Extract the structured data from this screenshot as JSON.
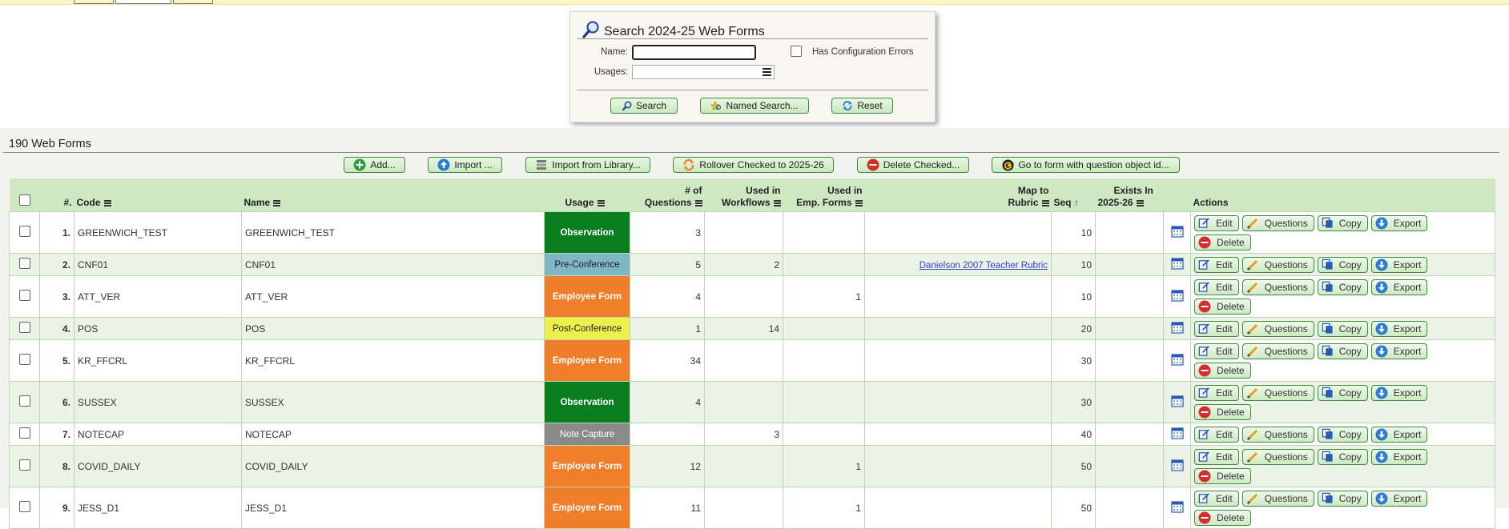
{
  "search": {
    "title": "Search 2024-25 Web Forms",
    "name_label": "Name:",
    "name_value": "",
    "usages_label": "Usages:",
    "config_errors_label": "Has Configuration Errors",
    "search_label": "Search",
    "named_search_label": "Named Search...",
    "reset_label": "Reset"
  },
  "main": {
    "title": "190 Web Forms",
    "toolbar": {
      "add": "Add...",
      "import": "Import ...",
      "import_library": "Import from Library...",
      "rollover": "Rollover Checked to 2025-26",
      "delete_checked": "Delete Checked...",
      "goto_form": "Go to form with question object id..."
    }
  },
  "table": {
    "headers": {
      "num": "#.",
      "code": "Code",
      "name": "Name",
      "usage": "Usage",
      "questions_1": "# of",
      "questions_2": "Questions",
      "workflows_1": "Used in",
      "workflows_2": "Workflows",
      "empforms_1": "Used in",
      "empforms_2": "Emp. Forms",
      "rubric_1": "Map to",
      "rubric_2": "Rubric",
      "seq": "Seq",
      "exists_1": "Exists In",
      "exists_2": "2025-26",
      "actions": "Actions"
    },
    "action_labels": {
      "edit": "Edit",
      "questions": "Questions",
      "copy": "Copy",
      "export": "Export",
      "delete": "Delete"
    },
    "usage_colors": {
      "Observation": "#0a7d1e",
      "Pre-Conference": "#7fb6c6",
      "Employee Form": "#f07d2a",
      "Post-Conference": "#ecf04a",
      "Note Capture": "#8a8a8a"
    },
    "rows": [
      {
        "num": "1.",
        "code": "GREENWICH_TEST",
        "name": "GREENWICH_TEST",
        "usage": "Observation",
        "questions": "3",
        "workflows": "",
        "empforms": "",
        "rubric": "",
        "seq": "10",
        "delete": true
      },
      {
        "num": "2.",
        "code": "CNF01",
        "name": "CNF01",
        "usage": "Pre-Conference",
        "questions": "5",
        "workflows": "2",
        "empforms": "",
        "rubric": "Danielson 2007 Teacher Rubric",
        "seq": "10",
        "delete": false
      },
      {
        "num": "3.",
        "code": "ATT_VER",
        "name": "ATT_VER",
        "usage": "Employee Form",
        "questions": "4",
        "workflows": "",
        "empforms": "1",
        "rubric": "",
        "seq": "10",
        "delete": true
      },
      {
        "num": "4.",
        "code": "POS",
        "name": "POS",
        "usage": "Post-Conference",
        "questions": "1",
        "workflows": "14",
        "empforms": "",
        "rubric": "",
        "seq": "20",
        "delete": false
      },
      {
        "num": "5.",
        "code": "KR_FFCRL",
        "name": "KR_FFCRL",
        "usage": "Employee Form",
        "questions": "34",
        "workflows": "",
        "empforms": "",
        "rubric": "",
        "seq": "30",
        "delete": true
      },
      {
        "num": "6.",
        "code": "SUSSEX",
        "name": "SUSSEX",
        "usage": "Observation",
        "questions": "4",
        "workflows": "",
        "empforms": "",
        "rubric": "",
        "seq": "30",
        "delete": true
      },
      {
        "num": "7.",
        "code": "NOTECAP",
        "name": "NOTECAP",
        "usage": "Note Capture",
        "questions": "",
        "workflows": "3",
        "empforms": "",
        "rubric": "",
        "seq": "40",
        "delete": false
      },
      {
        "num": "8.",
        "code": "COVID_DAILY",
        "name": "COVID_DAILY",
        "usage": "Employee Form",
        "questions": "12",
        "workflows": "",
        "empforms": "1",
        "rubric": "",
        "seq": "50",
        "delete": true
      },
      {
        "num": "9.",
        "code": "JESS_D1",
        "name": "JESS_D1",
        "usage": "Employee Form",
        "questions": "11",
        "workflows": "",
        "empforms": "1",
        "rubric": "",
        "seq": "50",
        "delete": true
      }
    ]
  }
}
